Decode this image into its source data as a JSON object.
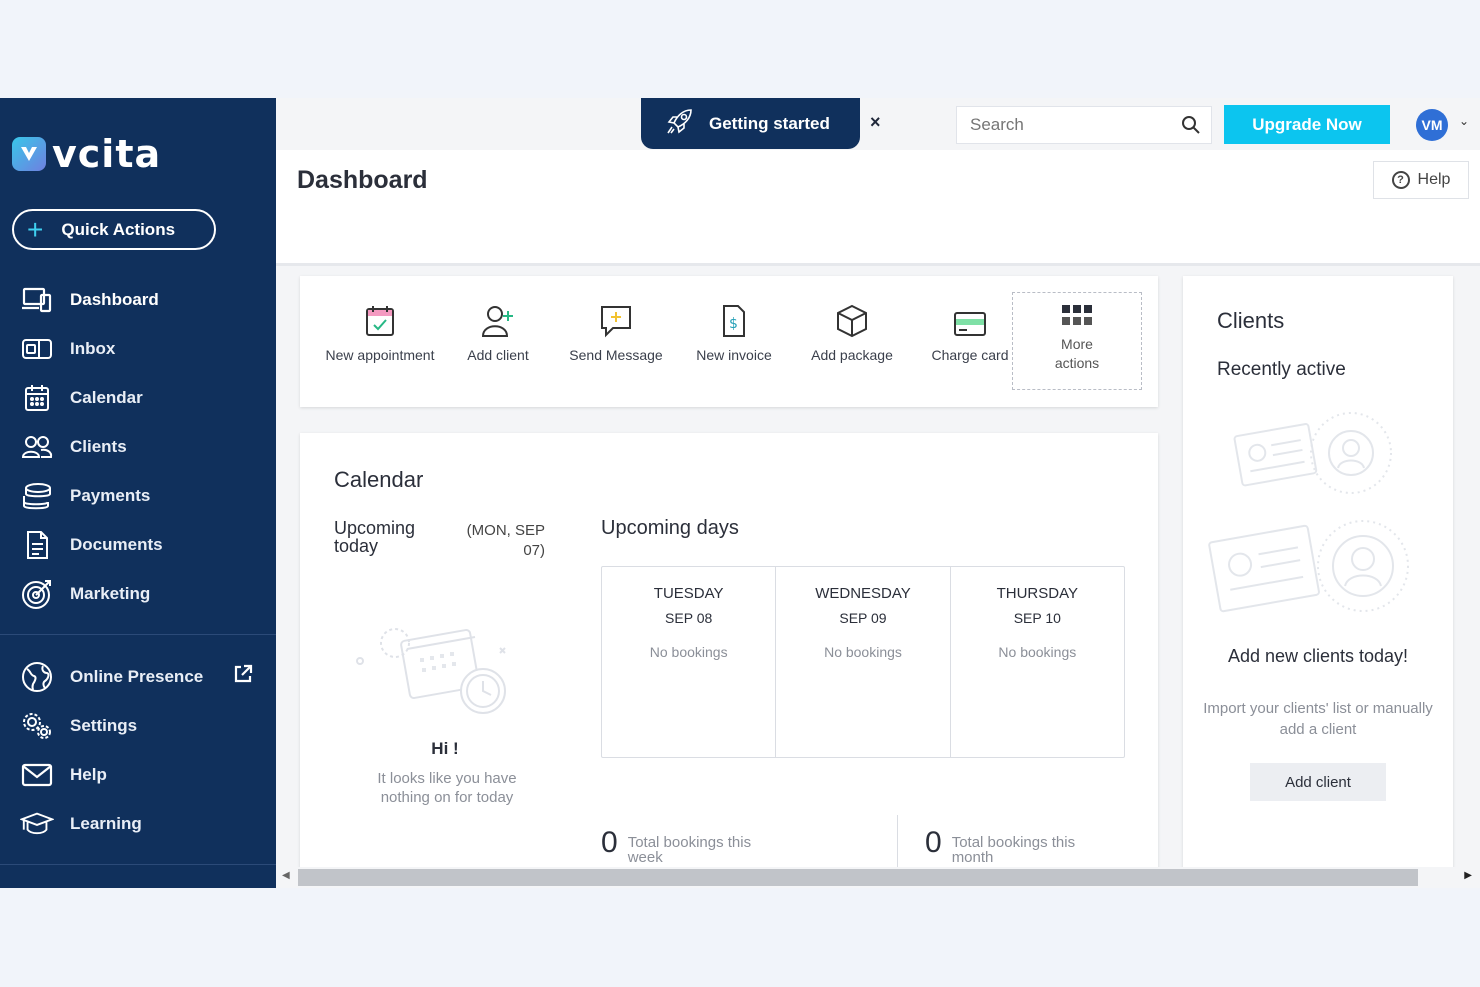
{
  "app": {
    "brand": "vcita"
  },
  "sidebar": {
    "quick_actions": "Quick Actions",
    "items": [
      {
        "label": "Dashboard",
        "icon": "dashboard-icon"
      },
      {
        "label": "Inbox",
        "icon": "inbox-icon"
      },
      {
        "label": "Calendar",
        "icon": "calendar-icon"
      },
      {
        "label": "Clients",
        "icon": "clients-icon"
      },
      {
        "label": "Payments",
        "icon": "payments-icon"
      },
      {
        "label": "Documents",
        "icon": "documents-icon"
      },
      {
        "label": "Marketing",
        "icon": "marketing-icon"
      }
    ],
    "items2": [
      {
        "label": "Online Presence",
        "icon": "globe-icon"
      },
      {
        "label": "Settings",
        "icon": "settings-icon"
      },
      {
        "label": "Help",
        "icon": "help-mail-icon"
      },
      {
        "label": "Learning",
        "icon": "graduation-cap-icon"
      }
    ]
  },
  "topbar": {
    "getting_started": "Getting started",
    "close": "×",
    "search_placeholder": "Search",
    "upgrade": "Upgrade Now",
    "avatar": "VM"
  },
  "header": {
    "title": "Dashboard",
    "help": "Help"
  },
  "actions": [
    {
      "label": "New appointment",
      "icon": "calendar-check-icon"
    },
    {
      "label": "Add client",
      "icon": "add-user-icon"
    },
    {
      "label": "Send Message",
      "icon": "message-icon"
    },
    {
      "label": "New invoice",
      "icon": "invoice-icon"
    },
    {
      "label": "Add package",
      "icon": "package-icon"
    },
    {
      "label": "Charge card",
      "icon": "credit-card-icon"
    }
  ],
  "more_actions": "More actions",
  "calendar": {
    "title": "Calendar",
    "upcoming_today": "Upcoming today",
    "today_date": "(MON, SEP 07)",
    "hi": "Hi !",
    "hi_sub": "It looks like you have nothing on for today",
    "upcoming_days": "Upcoming days",
    "days": [
      {
        "name": "TUESDAY",
        "date": "SEP 08",
        "status": "No bookings"
      },
      {
        "name": "WEDNESDAY",
        "date": "SEP 09",
        "status": "No bookings"
      },
      {
        "name": "THURSDAY",
        "date": "SEP 10",
        "status": "No bookings"
      }
    ],
    "week_total": "0",
    "week_label": "Total bookings this week",
    "month_total": "0",
    "month_label": "Total bookings this month"
  },
  "clients": {
    "title": "Clients",
    "recently": "Recently active",
    "add_new": "Add new clients today!",
    "add_new_sub": "Import your clients' list or manually add a client",
    "add_client": "Add client"
  },
  "colors": {
    "sidebar": "#10305c",
    "accent": "#0cc5ef",
    "avatar": "#2f6fd6"
  }
}
